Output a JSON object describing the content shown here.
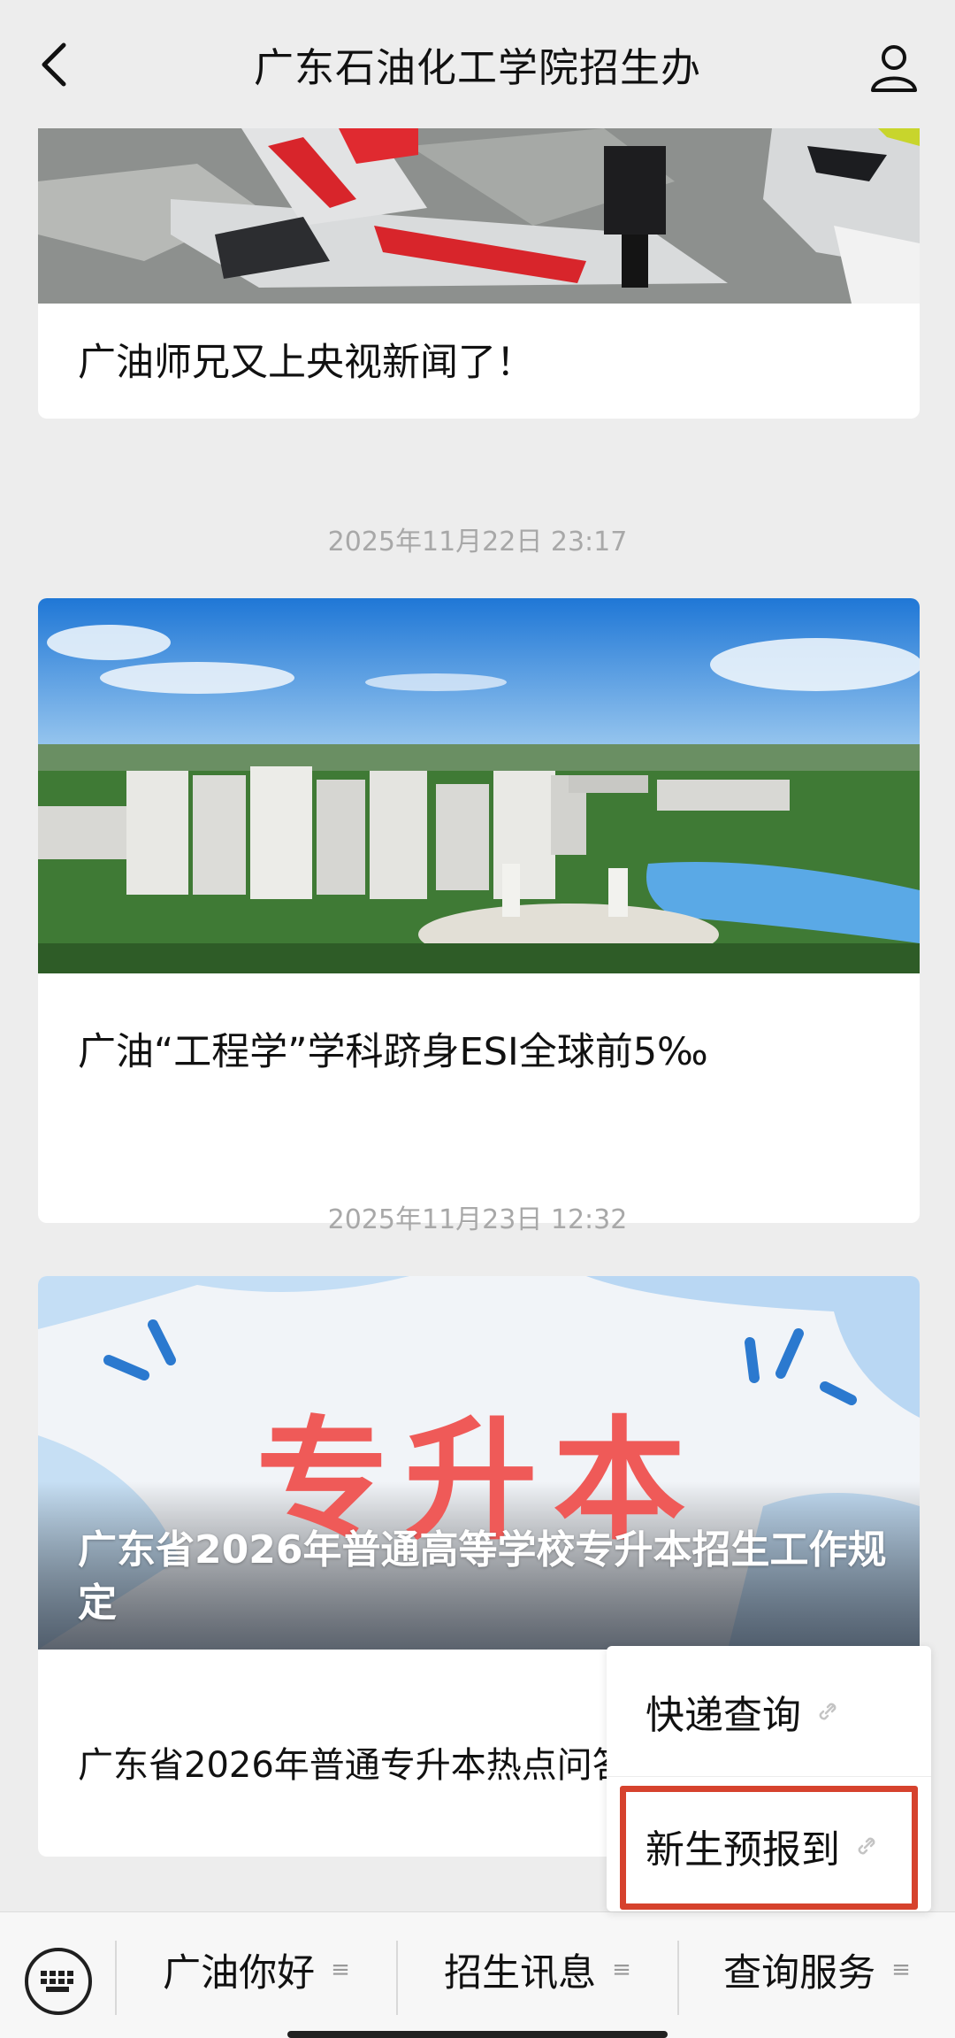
{
  "header": {
    "title": "广东石油化工学院招生办",
    "back_icon": "chevron-left-icon",
    "profile_icon": "person-icon"
  },
  "articles": [
    {
      "title": "广油师兄又上央视新闻了！"
    },
    {
      "timestamp": "2025年11月22日 23:17",
      "title": "广油“工程学”学科跻身ESI全球前5‰"
    },
    {
      "timestamp": "2025年11月23日 12:32",
      "banner_text": "专升本",
      "title": "广东省2026年普通高等学校专升本招生工作规定",
      "subtitle": "广东省2026年普通专升本热点问答"
    }
  ],
  "popup_menu": {
    "items": [
      {
        "label": "快递查询",
        "icon": "link-icon"
      },
      {
        "label": "新生预报到",
        "icon": "link-icon",
        "highlighted": true
      }
    ]
  },
  "bottom_menu": {
    "keyboard_icon": "keyboard-icon",
    "tabs": [
      {
        "label": "广油你好",
        "icon": "menu-lines-icon"
      },
      {
        "label": "招生讯息",
        "icon": "menu-lines-icon"
      },
      {
        "label": "查询服务",
        "icon": "menu-lines-icon"
      }
    ]
  },
  "colors": {
    "background": "#ededed",
    "highlight_border": "#d6422d",
    "timestamp": "#a8a8a8"
  }
}
